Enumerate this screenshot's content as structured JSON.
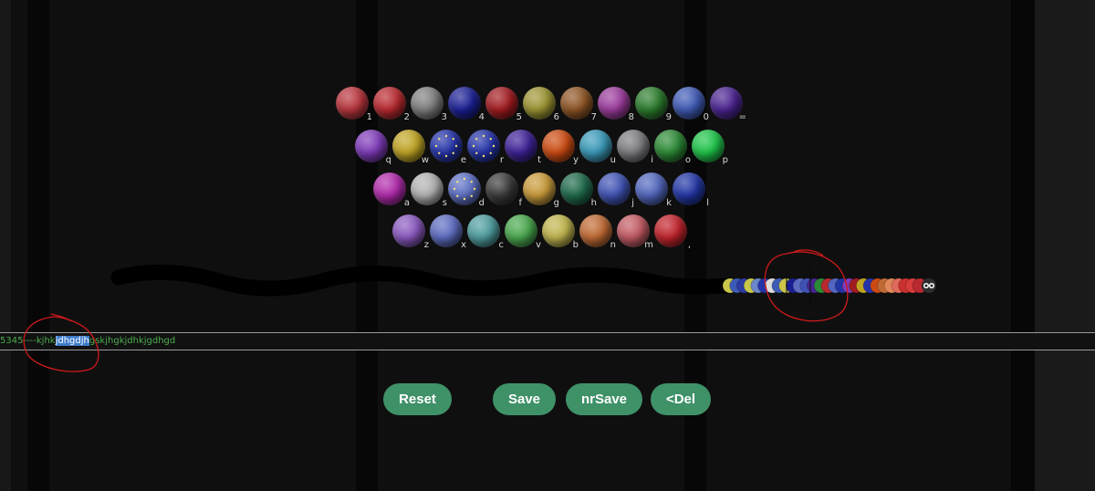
{
  "keyboard": {
    "rows": [
      [
        {
          "label": "1",
          "color": "#b8353d"
        },
        {
          "label": "2",
          "color": "#b8292f"
        },
        {
          "label": "3",
          "color": "#7f7f7f"
        },
        {
          "label": "4",
          "color": "#1b1f93"
        },
        {
          "label": "5",
          "color": "#a11b20"
        },
        {
          "label": "6",
          "color": "#9c9433"
        },
        {
          "label": "7",
          "color": "#8e5424"
        },
        {
          "label": "8",
          "color": "#9b3b9b"
        },
        {
          "label": "9",
          "color": "#2c7c2d"
        },
        {
          "label": "0",
          "color": "#3f5ab5"
        },
        {
          "label": "=",
          "color": "#4a2390"
        }
      ],
      [
        {
          "label": "q",
          "color": "#7e3ab8"
        },
        {
          "label": "w",
          "color": "#c0a524"
        },
        {
          "label": "e",
          "color": "#2433a8",
          "stars": true
        },
        {
          "label": "r",
          "color": "#2433a8",
          "stars": true
        },
        {
          "label": "t",
          "color": "#3d2196"
        },
        {
          "label": "y",
          "color": "#cc4b12"
        },
        {
          "label": "u",
          "color": "#3a9ab9"
        },
        {
          "label": "i",
          "color": "#7d7d82"
        },
        {
          "label": "o",
          "color": "#2b8a35"
        },
        {
          "label": "p",
          "color": "#1fc44a"
        }
      ],
      [
        {
          "label": "a",
          "color": "#b02aab"
        },
        {
          "label": "s",
          "color": "#b2b2b2"
        },
        {
          "label": "d",
          "color": "#5d6fc3",
          "stars": true
        },
        {
          "label": "f",
          "color": "#3a3a3a"
        },
        {
          "label": "g",
          "color": "#c89a3a"
        },
        {
          "label": "h",
          "color": "#1e6a4b"
        },
        {
          "label": "j",
          "color": "#3f52b4"
        },
        {
          "label": "k",
          "color": "#5266be"
        },
        {
          "label": "l",
          "color": "#2235a4"
        }
      ],
      [
        {
          "label": "z",
          "color": "#8a59bf"
        },
        {
          "label": "x",
          "color": "#5c6bc0"
        },
        {
          "label": "c",
          "color": "#4f9da0"
        },
        {
          "label": "v",
          "color": "#49a84e"
        },
        {
          "label": "b",
          "color": "#bfb44d"
        },
        {
          "label": "n",
          "color": "#c06a34"
        },
        {
          "label": "m",
          "color": "#c35a63"
        },
        {
          "label": ",",
          "color": "#c0232b"
        }
      ]
    ]
  },
  "text_strip": {
    "prefix": "5345----kjhk",
    "selected": "jdhgdjh",
    "suffix": "gskjhgkjdhkjgdhgd"
  },
  "buttons": {
    "reset": "Reset",
    "save": "Save",
    "nrsave": "nrSave",
    "del": "<Del"
  },
  "worm": {
    "segment_colors": [
      "#c9c64a",
      "#3d5bb6",
      "#2d3aa4",
      "#c9c64a",
      "#6b86c9",
      "#2433a8",
      "#dcdcdc",
      "#3d5bb6",
      "#c9c64a",
      "#1b1f93",
      "#5c6bc0",
      "#3f52b4",
      "#4a2390",
      "#2b8a35",
      "#b8292f",
      "#5266be",
      "#2235a4",
      "#7e3ab8",
      "#a11b20",
      "#c0a524",
      "#2433a8",
      "#cc4b12",
      "#c06a34",
      "#e0885a",
      "#e06a5a",
      "#c9302f",
      "#d73b3b",
      "#b8292f"
    ]
  },
  "colors": {
    "background": "#0f0f0f",
    "button": "#3f9168",
    "text_green": "#4caf50",
    "selection": "#3d7cc9",
    "annotation_red": "#d11a1a"
  }
}
